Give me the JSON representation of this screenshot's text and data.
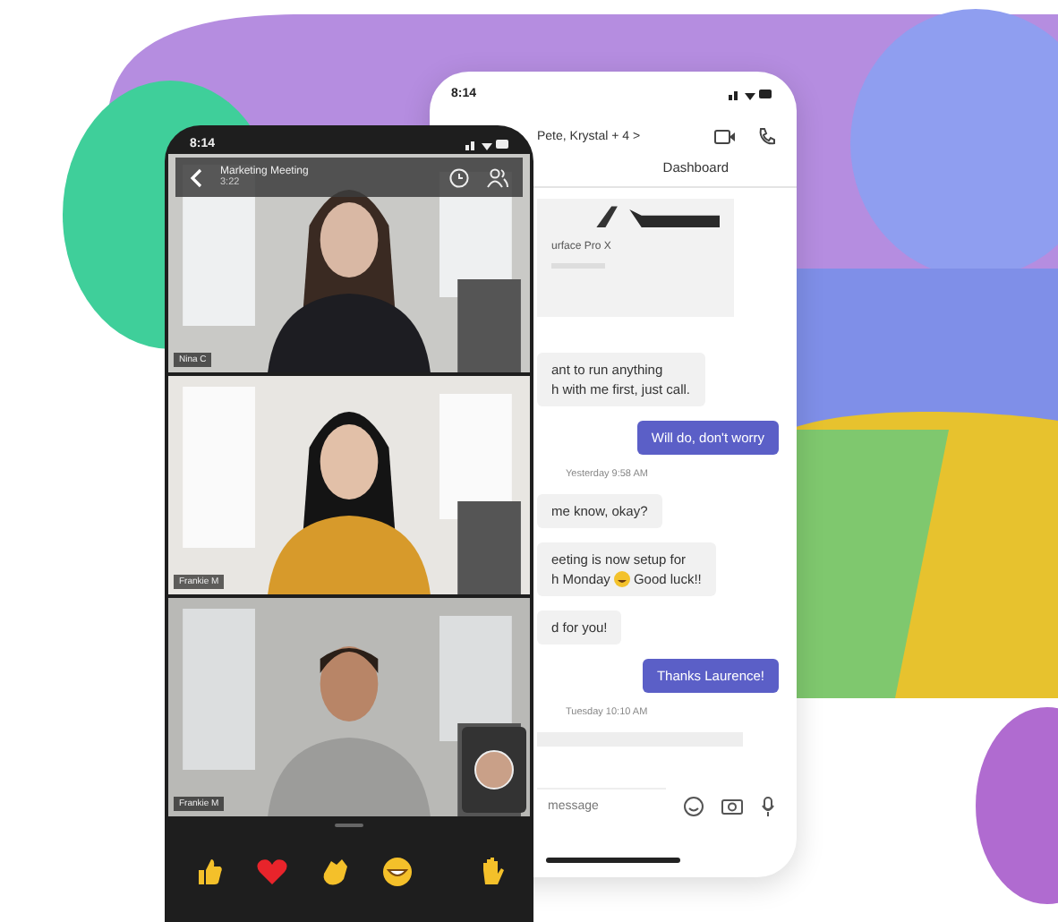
{
  "chat_phone": {
    "time": "8:14",
    "chat_title": "Pete, Krystal + 4 >",
    "tab": "Dashboard",
    "card_title": "urface Pro X",
    "messages": [
      {
        "kind": "received",
        "lines": [
          "ant to run anything",
          "h with me first, just call."
        ]
      },
      {
        "kind": "sent",
        "lines": [
          "Will do, don't worry"
        ]
      },
      {
        "kind": "timestamp",
        "lines": [
          "Yesterday 9:58 AM"
        ]
      },
      {
        "kind": "received",
        "lines": [
          "me know, okay?"
        ]
      },
      {
        "kind": "received_emoji",
        "lines": [
          "eeting is now setup for",
          "h Monday",
          "Good luck!!"
        ]
      },
      {
        "kind": "received",
        "lines": [
          "d for you!"
        ]
      },
      {
        "kind": "sent",
        "lines": [
          "Thanks Laurence!"
        ]
      },
      {
        "kind": "timestamp",
        "lines": [
          "Tuesday 10:10 AM"
        ]
      }
    ],
    "compose": {
      "placeholder": "message"
    }
  },
  "meeting_phone": {
    "time": "8:14",
    "meeting_title": "Marketing Meeting",
    "duration": "3:22",
    "tiles": [
      {
        "name": "Nina C",
        "kind": "city",
        "self_view": false
      },
      {
        "name": "Frankie M",
        "kind": "studio",
        "self_view": false
      },
      {
        "name": "Frankie M",
        "kind": "office",
        "self_view": true
      }
    ],
    "reactions": [
      {
        "kind": "thumbs_up"
      },
      {
        "kind": "heart"
      },
      {
        "kind": "clap"
      },
      {
        "kind": "laugh"
      },
      {
        "kind": "raise_hand"
      }
    ]
  }
}
